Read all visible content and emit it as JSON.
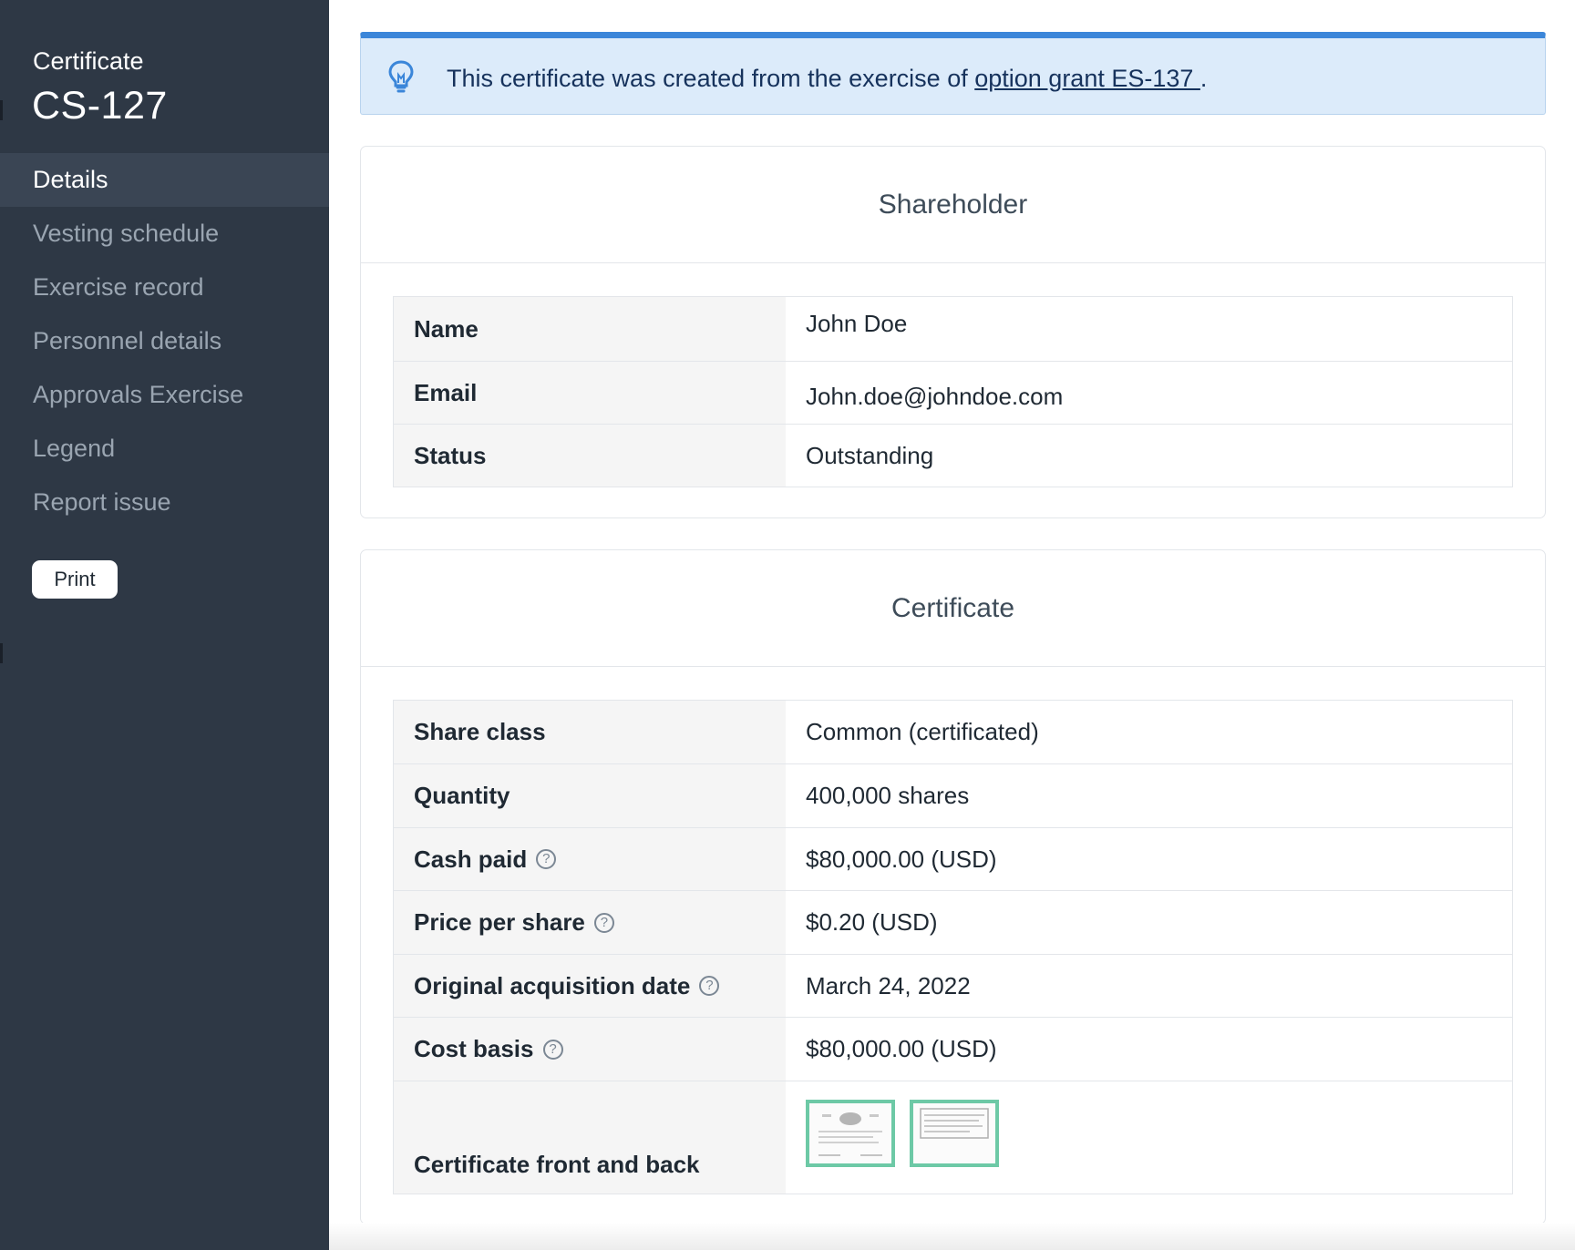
{
  "sidebar": {
    "eyebrow": "Certificate",
    "cert_id": "CS-127",
    "nav": [
      {
        "label": "Details",
        "active": true
      },
      {
        "label": "Vesting schedule"
      },
      {
        "label": "Exercise record"
      },
      {
        "label": "Personnel details"
      },
      {
        "label": "Approvals Exercise"
      },
      {
        "label": "Legend"
      },
      {
        "label": "Report issue"
      }
    ],
    "print_label": "Print"
  },
  "banner": {
    "icon": "lightbulb-icon",
    "text": "This certificate was created from the exercise of ",
    "link": "option grant ES-137 ",
    "suffix": "."
  },
  "shareholder": {
    "title": "Shareholder",
    "rows": [
      {
        "label": "Name",
        "value": "John Doe"
      },
      {
        "label": "Email",
        "value": "John.doe@johndoe.com"
      },
      {
        "label": "Status",
        "value": "Outstanding"
      }
    ]
  },
  "certificate": {
    "title": "Certificate",
    "rows": [
      {
        "label": "Share class",
        "value": "Common (certificated)"
      },
      {
        "label": "Quantity",
        "value": "400,000 shares"
      },
      {
        "label": "Cash paid",
        "value": "$80,000.00 (USD)",
        "help": true
      },
      {
        "label": "Price per share",
        "value": "$0.20 (USD)",
        "help": true
      },
      {
        "label": "Original acquisition date",
        "value": "March 24, 2022",
        "help": true
      },
      {
        "label": "Cost basis",
        "value": "$80,000.00 (USD)",
        "help": true
      },
      {
        "label": "Certificate front and back"
      }
    ],
    "help_glyph": "?"
  },
  "colors": {
    "sidebar_bg": "#2e3845",
    "banner_bg": "#dcebfa",
    "banner_accent": "#3b86d9",
    "thumb_border": "#6dc9a6"
  }
}
